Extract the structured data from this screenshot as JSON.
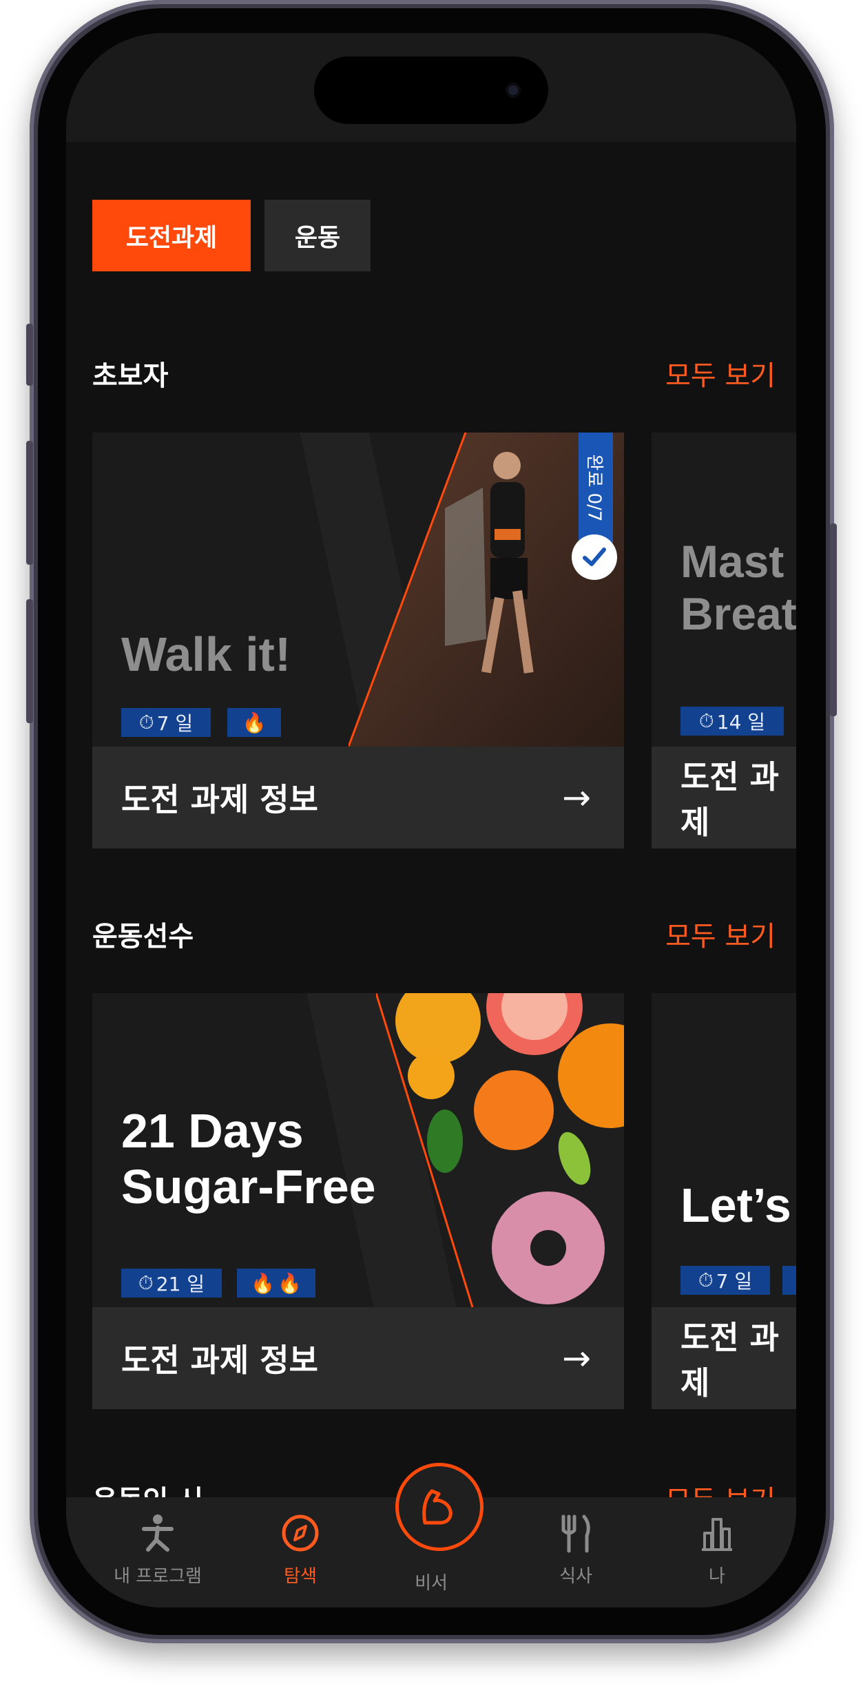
{
  "tabs": {
    "active_label": "도전과제",
    "inactive_label": "운동"
  },
  "sections": [
    {
      "title": "초보자",
      "see_all": "모두 보기",
      "cards": [
        {
          "title_lines": [
            "Walk it!"
          ],
          "days": "7 일",
          "intensity_flames": 1,
          "progress_badge": "완료 0/7",
          "info_label": "도전 과제 정보"
        },
        {
          "title_lines": [
            "Mast",
            "Breat"
          ],
          "days": "14 일",
          "info_label": "도전 과제"
        }
      ]
    },
    {
      "title": "운동선수",
      "see_all": "모두 보기",
      "cards": [
        {
          "title_lines": [
            "21 Days",
            "Sugar-Free"
          ],
          "days": "21 일",
          "intensity_flames": 2,
          "info_label": "도전 과제 정보"
        },
        {
          "title_lines": [
            "Let’s"
          ],
          "days": "7 일",
          "info_label": "도전 과제"
        }
      ]
    },
    {
      "title": "운동인 시",
      "see_all": "모두 보기"
    }
  ],
  "bottom_nav": {
    "items": [
      {
        "label": "내 프로그램",
        "icon": "runner-icon"
      },
      {
        "label": "탐색",
        "icon": "compass-icon"
      },
      {
        "label": "비서",
        "icon": "arm-flex-icon"
      },
      {
        "label": "식사",
        "icon": "fork-knife-icon"
      },
      {
        "label": "나",
        "icon": "bar-chart-icon"
      }
    ],
    "active_index": 1
  },
  "colors": {
    "accent": "#ff4a0c",
    "background": "#111111",
    "card": "#1b1b1b",
    "info_bar": "#2b2b2b",
    "pill": "#12418f",
    "badge": "#1a56b6"
  }
}
